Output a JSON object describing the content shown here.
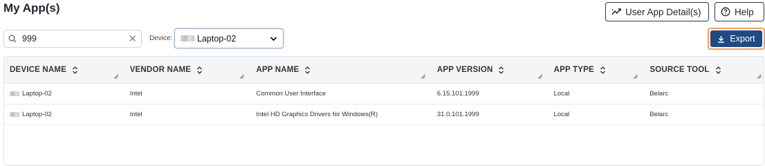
{
  "page": {
    "title": "My App(s)"
  },
  "toolbar": {
    "user_app_detail_label": "User App Detail(s)",
    "help_label": "Help",
    "export_label": "Export",
    "accent_color": "#1f4a82",
    "focus_outline_color": "#f0a060"
  },
  "search": {
    "value": "999",
    "placeholder": ""
  },
  "device_filter": {
    "label": "Device:",
    "selected": "Laptop-02"
  },
  "grid": {
    "columns": [
      "DEVICE NAME",
      "VENDOR NAME",
      "APP NAME",
      "APP VERSION",
      "APP TYPE",
      "SOURCE TOOL"
    ],
    "rows": [
      {
        "device": "Laptop-02",
        "vendor": "Intel",
        "app": "Common User Interface",
        "version": "6.15.101.1999",
        "type": "Local",
        "source": "Belarc"
      },
      {
        "device": "Laptop-02",
        "vendor": "Intel",
        "app": "Intel HD Graphics Drivers for Windows(R)",
        "version": "31.0.101.1999",
        "type": "Local",
        "source": "Belarc"
      }
    ]
  }
}
